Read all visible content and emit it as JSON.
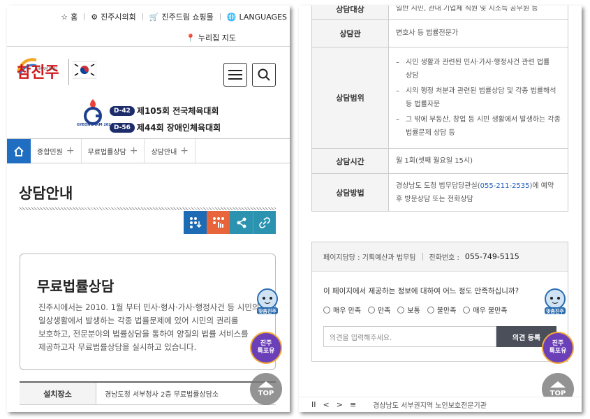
{
  "utility": {
    "home": "홈",
    "council": "진주시의회",
    "mall": "진주드림 쇼핑몰",
    "languages": "LANGUAGES",
    "map": "누리집 지도"
  },
  "logo": {
    "main": "참진주",
    "sub": "CHARM JINJU"
  },
  "event": {
    "emblem": "GYEONGNAM 2024",
    "rows": [
      {
        "badge": "D-42",
        "title": "제105회 전국체육대회"
      },
      {
        "badge": "D-56",
        "title": "제44회 장애인체육대회"
      }
    ]
  },
  "gnb": {
    "items": [
      "종합민원",
      "무료법률상담",
      "상담안내"
    ]
  },
  "page": {
    "title": "상담안내"
  },
  "share_buttons": {
    "colors": [
      "#1d6bb5",
      "#e8643a",
      "#2b93b0",
      "#2b93b0"
    ]
  },
  "intro": {
    "title": "무료법률상담",
    "body": "진주시에서는 2010. 1월 부터 민사·형사·가사·행정사건 등 시민의 일상생활에서 발생하는 각종 법률문제에 있어 시민의 권리를 보호하고, 전문분야의 법률상담을 통하여 양질의 법률 서비스를 제공하고자 무료법률상담을 실시하고 있습니다."
  },
  "location": {
    "label": "설치장소",
    "value": "경남도청 서부청사 2층 무료법률상담소"
  },
  "floating": {
    "character": "맞춤진주",
    "talk_line1": "진주",
    "talk_line2": "톡포유",
    "top": "TOP"
  },
  "table": {
    "rows": [
      {
        "label": "상담대상",
        "value": "일반 시민, 관내 기업체 직원 및 지소득 공무원 등"
      },
      {
        "label": "상담관",
        "value": "변호사 등 법률전문가"
      },
      {
        "label": "상담범위",
        "items": [
          "시민 생활과 관련된 민사·가사·행정사건 관련 법률 상담",
          "시의 행정 처분과 관련된 법률상담 및 각종 법률해석 등 법률자문",
          "그 밖에 부동산, 창업 등 시민 생활에서 발생하는 각종 법률문제 상담 등"
        ]
      },
      {
        "label": "상담시간",
        "value": "월 1회(셋째 월요일 15시)"
      },
      {
        "label": "상담방법",
        "value_pre": "경상남도 도청 법무담당관실(",
        "phone": "055-211-2535",
        "value_post": ")에 예약 후 방문상담 또는 전화상담"
      }
    ]
  },
  "survey": {
    "manager": "페이지담당 : 기획예산과 법무팀",
    "phone_label": "전화번호 :",
    "phone": "055-749-5115",
    "question": "이 페이지에서 제공하는 정보에 대하여 어느 정도 만족하십니까?",
    "options": [
      "매우 만족",
      "만족",
      "보통",
      "불만족",
      "매우 불만족"
    ],
    "placeholder": "의견을 입력해주세요.",
    "submit": "의견 등록"
  },
  "bottom": {
    "controls": [
      "II",
      "<",
      ">",
      "≡"
    ],
    "text": "경상남도 서부권지역 노인보호전문기관"
  }
}
